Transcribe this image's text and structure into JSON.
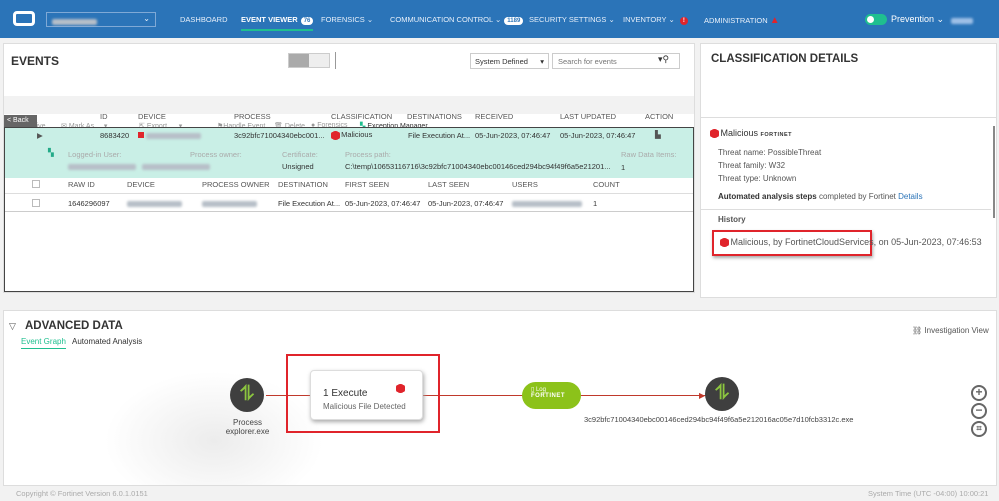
{
  "nav": {
    "items": [
      "DASHBOARD",
      "EVENT VIEWER",
      "FORENSICS",
      "COMMUNICATION CONTROL",
      "SECURITY SETTINGS",
      "INVENTORY",
      "ADMINISTRATION"
    ],
    "event_viewer_badge": "76",
    "comm_badge": "1189",
    "inventory_badge": "!",
    "mode": "Prevention"
  },
  "events": {
    "title": "EVENTS",
    "filter": "System Defined",
    "search_placeholder": "Search for events",
    "toolbar": [
      "Archive",
      "Mark As..",
      "Export",
      "Handle Event",
      "Delete",
      "Forensics",
      "Exception Manager"
    ],
    "back": "< Back",
    "columns": [
      "ID",
      "DEVICE",
      "PROCESS",
      "CLASSIFICATION",
      "DESTINATIONS",
      "RECEIVED",
      "LAST UPDATED",
      "ACTION"
    ],
    "row": {
      "id": "8683420",
      "process": "3c92bfc71004340ebc001...",
      "classification": "Malicious",
      "destinations": "File Execution At...",
      "received": "05-Jun-2023, 07:46:47",
      "last_updated": "05-Jun-2023, 07:46:47"
    },
    "detail": {
      "logged_in_user_label": "Logged-in User:",
      "process_owner_label": "Process owner:",
      "certificate_label": "Certificate:",
      "certificate": "Unsigned",
      "process_path_label": "Process path:",
      "process_path": "C:\\temp\\10653116716\\3c92bfc71004340ebc00146ced294bc94f49f6a5e21201...",
      "raw_items_label": "Raw Data Items:",
      "raw_items": "1"
    },
    "raw_columns": [
      "RAW ID",
      "DEVICE",
      "PROCESS OWNER",
      "DESTINATION",
      "FIRST SEEN",
      "LAST SEEN",
      "USERS",
      "COUNT"
    ],
    "raw_row": {
      "raw_id": "1646296097",
      "destination": "File Execution At...",
      "first_seen": "05-Jun-2023, 07:46:47",
      "last_seen": "05-Jun-2023, 07:46:47",
      "count": "1"
    }
  },
  "classification": {
    "title": "CLASSIFICATION DETAILS",
    "verdict": "Malicious",
    "vendor": "FORTINET",
    "threat_name": "Threat name: PossibleThreat",
    "threat_family": "Threat family: W32",
    "threat_type": "Threat type: Unknown",
    "analysis_bold": "Automated analysis steps",
    "analysis_rest": "completed by Fortinet",
    "details_link": "Details",
    "history_label": "History",
    "history_entry": "Malicious, by FortinetCloudServices,",
    "history_date": "on 05-Jun-2023, 07:46:53"
  },
  "advanced": {
    "title": "ADVANCED DATA",
    "tabs": [
      "Event Graph",
      "Automated Analysis"
    ],
    "investigation_view": "Investigation View",
    "process_label": "Process",
    "process_name": "explorer.exe",
    "execute_title": "1 Execute",
    "execute_sub": "Malicious File Detected",
    "log_label": "Log",
    "log_vendor": "FORTINET",
    "target": "3c92bfc71004340ebc00146ced294bc94f49f6a5e212016ac05e7d10fcb3312c.exe"
  },
  "footer": {
    "copyright": "Copyright © Fortinet Version 6.0.1.0151",
    "system_time": "System Time (UTC -04:00) 10:00:21"
  }
}
